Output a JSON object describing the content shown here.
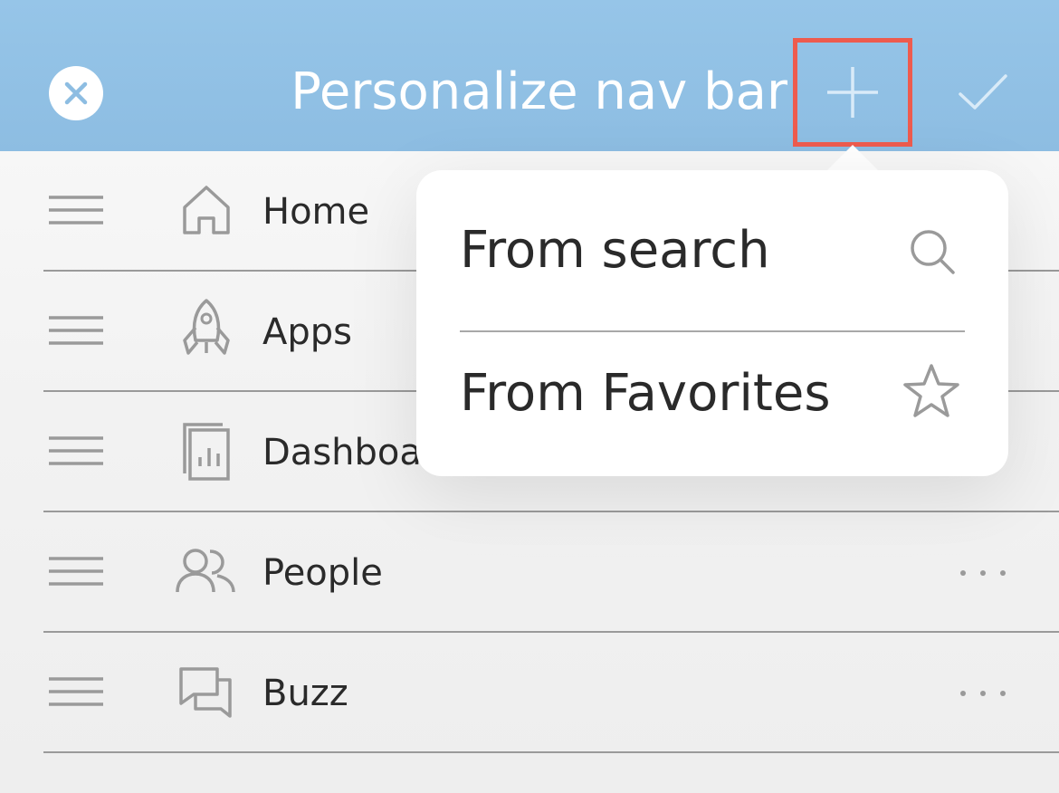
{
  "header": {
    "title": "Personalize nav bar",
    "close_icon": "close-icon",
    "add_icon": "plus-icon",
    "done_icon": "check-icon"
  },
  "nav_items": [
    {
      "label": "Home",
      "icon": "home-icon",
      "has_more": false
    },
    {
      "label": "Apps",
      "icon": "rocket-icon",
      "has_more": false
    },
    {
      "label": "Dashboards",
      "icon": "dashboard-icon",
      "has_more": false
    },
    {
      "label": "People",
      "icon": "people-icon",
      "has_more": true
    },
    {
      "label": "Buzz",
      "icon": "chat-icon",
      "has_more": true
    }
  ],
  "popover": {
    "items": [
      {
        "label": "From search",
        "icon": "search-icon"
      },
      {
        "label": "From Favorites",
        "icon": "star-icon"
      }
    ]
  },
  "colors": {
    "header_background": "#8dbde2",
    "highlight_border": "#ee5b4e",
    "text": "#2a2a2a",
    "icon_gray": "#9a9a9a"
  }
}
